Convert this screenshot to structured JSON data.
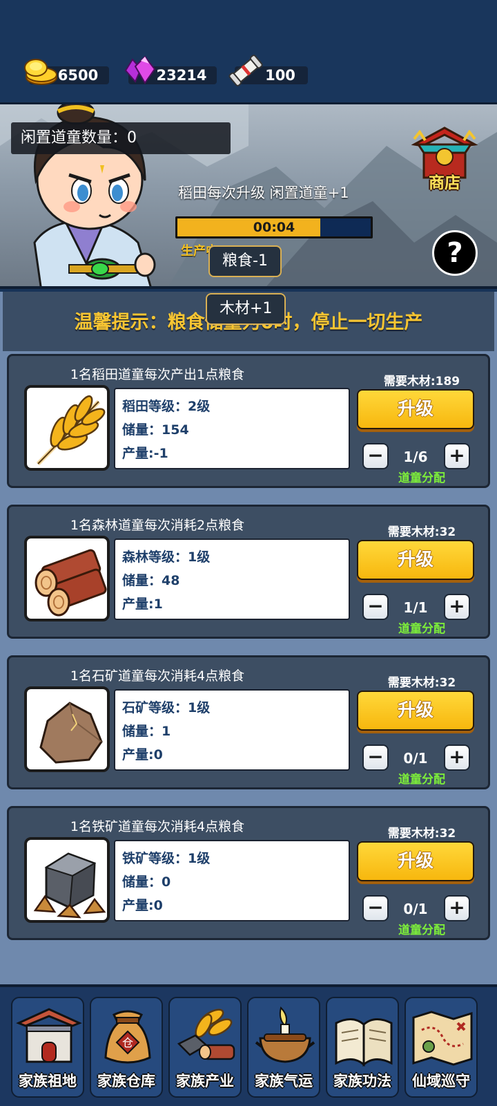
{
  "currencies": [
    {
      "name": "gold",
      "icon": "gold-coins-icon",
      "value": "6500"
    },
    {
      "name": "gem",
      "icon": "purple-gem-icon",
      "value": "23214"
    },
    {
      "name": "scroll",
      "icon": "scroll-icon",
      "value": "100"
    }
  ],
  "banner": {
    "idle_label": "闲置道童数量：0",
    "upgrade_hint": "稻田每次升级 闲置道童+1",
    "timer": "00:04",
    "progress": 0.74,
    "producing": "生产中",
    "float_food": "粮食-1",
    "shop_label": "商店",
    "help_label": "?"
  },
  "tip": {
    "text": "温馨提示：粮食储量为0时，停止一切生产",
    "float_wood": "木材+1"
  },
  "cards": [
    {
      "title": "1名稻田道童每次产出1点粮食",
      "icon": "wheat-icon",
      "level": "稻田等级：2级",
      "storage": "储量：154",
      "output": "产量:-1",
      "requirement": "需要木材:189",
      "upgrade": "升级",
      "allocation": "1/6",
      "alloc_label": "道童分配"
    },
    {
      "title": "1名森林道童每次消耗2点粮食",
      "icon": "wood-logs-icon",
      "level": "森林等级：1级",
      "storage": "储量：48",
      "output": "产量:1",
      "requirement": "需要木材:32",
      "upgrade": "升级",
      "allocation": "1/1",
      "alloc_label": "道童分配"
    },
    {
      "title": "1名石矿道童每次消耗4点粮食",
      "icon": "stone-icon",
      "level": "石矿等级：1级",
      "storage": "储量：1",
      "output": "产量:0",
      "requirement": "需要木材:32",
      "upgrade": "升级",
      "allocation": "0/1",
      "alloc_label": "道童分配"
    },
    {
      "title": "1名铁矿道童每次消耗4点粮食",
      "icon": "iron-ore-icon",
      "level": "铁矿等级：1级",
      "storage": "储量：0",
      "output": "产量:0",
      "requirement": "需要木材:32",
      "upgrade": "升级",
      "allocation": "0/1",
      "alloc_label": "道童分配"
    }
  ],
  "stepper": {
    "minus": "−",
    "plus": "+"
  },
  "nav": [
    {
      "label": "家族祖地",
      "icon": "ancestral-hall-icon"
    },
    {
      "label": "家族仓库",
      "icon": "warehouse-sack-icon"
    },
    {
      "label": "家族产业",
      "icon": "industry-icon"
    },
    {
      "label": "家族气运",
      "icon": "incense-burner-icon"
    },
    {
      "label": "家族功法",
      "icon": "technique-book-icon"
    },
    {
      "label": "仙域巡守",
      "icon": "treasure-map-icon"
    }
  ],
  "colors": {
    "background": "#19365c",
    "accent_gold": "#f7b70e",
    "tip_text": "#f7c532",
    "alloc_green": "#7dee3a",
    "card": "#3d4e63"
  }
}
